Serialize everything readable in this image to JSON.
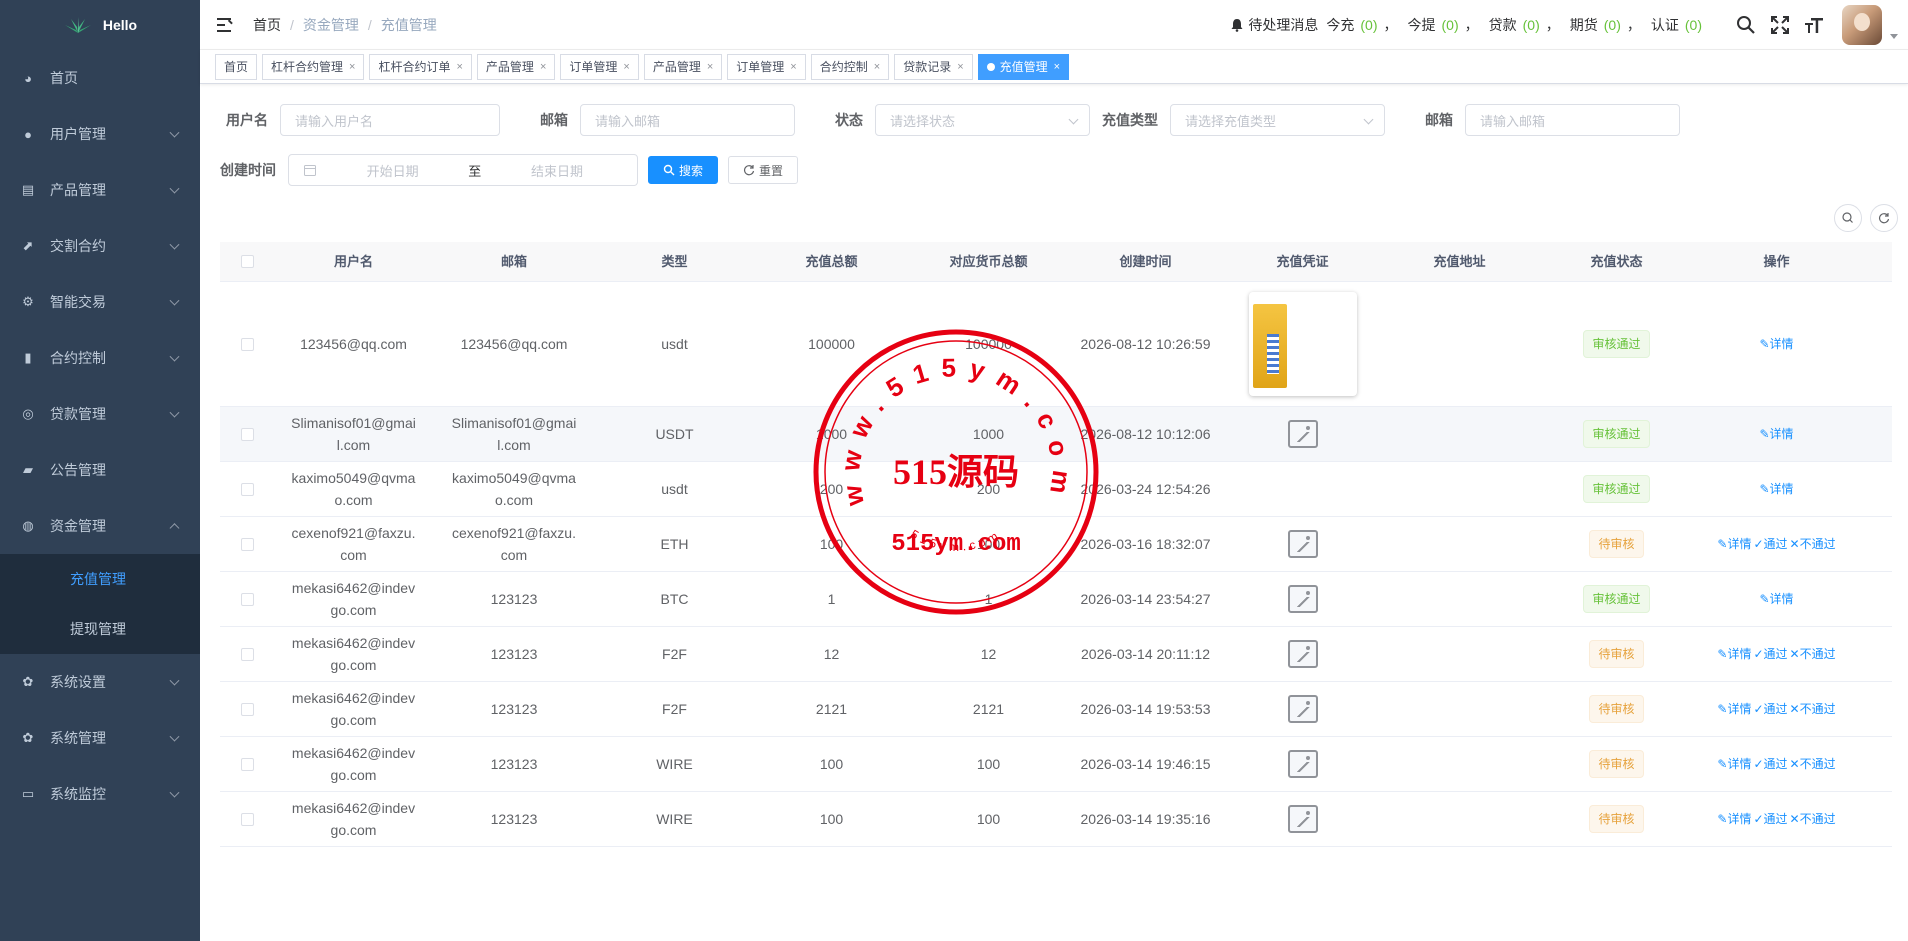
{
  "app": {
    "logo_text": "Hello"
  },
  "sidebar": {
    "items": [
      {
        "label": "首页",
        "icon": "dashboard-icon",
        "has_arrow": false
      },
      {
        "label": "用户管理",
        "icon": "user-icon",
        "has_arrow": true
      },
      {
        "label": "产品管理",
        "icon": "document-icon",
        "has_arrow": true
      },
      {
        "label": "交割合约",
        "icon": "chart-line-icon",
        "has_arrow": true
      },
      {
        "label": "智能交易",
        "icon": "gear-icon",
        "has_arrow": true
      },
      {
        "label": "合约控制",
        "icon": "bar-chart-icon",
        "has_arrow": true
      },
      {
        "label": "贷款管理",
        "icon": "coins-icon",
        "has_arrow": true
      },
      {
        "label": "公告管理",
        "icon": "message-icon",
        "has_arrow": false
      },
      {
        "label": "资金管理",
        "icon": "money-icon",
        "has_arrow": true,
        "expanded": true
      }
    ],
    "subitems": [
      {
        "label": "充值管理",
        "active": true
      },
      {
        "label": "提现管理",
        "active": false
      }
    ],
    "bottom_items": [
      {
        "label": "系统设置",
        "icon": "settings-icon"
      },
      {
        "label": "系统管理",
        "icon": "settings-icon"
      },
      {
        "label": "系统监控",
        "icon": "monitor-icon"
      }
    ]
  },
  "header": {
    "breadcrumb": [
      "首页",
      "资金管理",
      "充值管理"
    ],
    "notice": {
      "label": "待处理消息",
      "items": [
        {
          "label": "今充",
          "count": "(0)"
        },
        {
          "label": "今提",
          "count": "(0)"
        },
        {
          "label": "贷款",
          "count": "(0)"
        },
        {
          "label": "期货",
          "count": "(0)"
        },
        {
          "label": "认证",
          "count": "(0)"
        }
      ]
    }
  },
  "tags": [
    {
      "label": "首页",
      "closable": false,
      "active": false
    },
    {
      "label": "杠杆合约管理",
      "closable": true,
      "active": false
    },
    {
      "label": "杠杆合约订单",
      "closable": true,
      "active": false
    },
    {
      "label": "产品管理",
      "closable": true,
      "active": false
    },
    {
      "label": "订单管理",
      "closable": true,
      "active": false
    },
    {
      "label": "产品管理",
      "closable": true,
      "active": false
    },
    {
      "label": "订单管理",
      "closable": true,
      "active": false
    },
    {
      "label": "合约控制",
      "closable": true,
      "active": false
    },
    {
      "label": "贷款记录",
      "closable": true,
      "active": false
    },
    {
      "label": "充值管理",
      "closable": true,
      "active": true
    }
  ],
  "search": {
    "username_label": "用户名",
    "username_placeholder": "请输入用户名",
    "email_label": "邮箱",
    "email_placeholder": "请输入邮箱",
    "status_label": "状态",
    "status_placeholder": "请选择状态",
    "type_label": "充值类型",
    "type_placeholder": "请选择充值类型",
    "email2_label": "邮箱",
    "email2_placeholder": "请输入邮箱",
    "created_label": "创建时间",
    "start_placeholder": "开始日期",
    "range_sep": "至",
    "end_placeholder": "结束日期",
    "search_btn": "搜索",
    "reset_btn": "重置"
  },
  "table": {
    "columns": [
      "用户名",
      "邮箱",
      "类型",
      "充值总额",
      "对应货币总额",
      "创建时间",
      "充值凭证",
      "充值地址",
      "充值状态",
      "操作"
    ],
    "op_labels": {
      "detail": "详情",
      "approve": "通过",
      "reject": "不通过"
    },
    "rows": [
      {
        "username": "123456@qq.com",
        "email": "123456@qq.com",
        "type": "usdt",
        "amount": "100000",
        "currency_amount": "100000",
        "created": "2026-08-12 10:26:59",
        "voucher": "photo",
        "address": "",
        "status": "审核通过",
        "status_kind": "ok",
        "pending": false
      },
      {
        "username": "Slimanisof01@gmail.com",
        "email": "Slimanisof01@gmail.com",
        "type": "USDT",
        "amount": "1000",
        "currency_amount": "1000",
        "created": "2026-08-12 10:12:06",
        "voucher": "placeholder",
        "address": "",
        "status": "审核通过",
        "status_kind": "ok",
        "pending": false
      },
      {
        "username": "kaximo5049@qvmao.com",
        "email": "kaximo5049@qvmao.com",
        "type": "usdt",
        "amount": "200",
        "currency_amount": "200",
        "created": "2026-03-24 12:54:26",
        "voucher": "none",
        "address": "",
        "status": "审核通过",
        "status_kind": "ok",
        "pending": false
      },
      {
        "username": "cexenof921@faxzu.com",
        "email": "cexenof921@faxzu.com",
        "type": "ETH",
        "amount": "100",
        "currency_amount": "100",
        "created": "2026-03-16 18:32:07",
        "voucher": "placeholder",
        "address": "",
        "status": "待审核",
        "status_kind": "wait",
        "pending": true
      },
      {
        "username": "mekasi6462@indevgo.com",
        "email": "123123",
        "type": "BTC",
        "amount": "1",
        "currency_amount": "1",
        "created": "2026-03-14 23:54:27",
        "voucher": "placeholder",
        "address": "",
        "status": "审核通过",
        "status_kind": "ok",
        "pending": false
      },
      {
        "username": "mekasi6462@indevgo.com",
        "email": "123123",
        "type": "F2F",
        "amount": "12",
        "currency_amount": "12",
        "created": "2026-03-14 20:11:12",
        "voucher": "placeholder",
        "address": "",
        "status": "待审核",
        "status_kind": "wait",
        "pending": true
      },
      {
        "username": "mekasi6462@indevgo.com",
        "email": "123123",
        "type": "F2F",
        "amount": "2121",
        "currency_amount": "2121",
        "created": "2026-03-14 19:53:53",
        "voucher": "placeholder",
        "address": "",
        "status": "待审核",
        "status_kind": "wait",
        "pending": true
      },
      {
        "username": "mekasi6462@indevgo.com",
        "email": "123123",
        "type": "WIRE",
        "amount": "100",
        "currency_amount": "100",
        "created": "2026-03-14 19:46:15",
        "voucher": "placeholder",
        "address": "",
        "status": "待审核",
        "status_kind": "wait",
        "pending": true
      },
      {
        "username": "mekasi6462@indevgo.com",
        "email": "123123",
        "type": "WIRE",
        "amount": "100",
        "currency_amount": "100",
        "created": "2026-03-14 19:35:16",
        "voucher": "placeholder",
        "address": "",
        "status": "待审核",
        "status_kind": "wait",
        "pending": true
      }
    ]
  },
  "watermark": {
    "ring_text": "www.515ym.com",
    "center_text": "515源码",
    "domain_text": "515ym.com",
    "small_text": "515ym.com",
    "color": "#e60012"
  },
  "colors": {
    "primary": "#1890ff",
    "sidebar_bg": "#304156",
    "success": "#67c23a",
    "warning": "#e6a23c"
  }
}
